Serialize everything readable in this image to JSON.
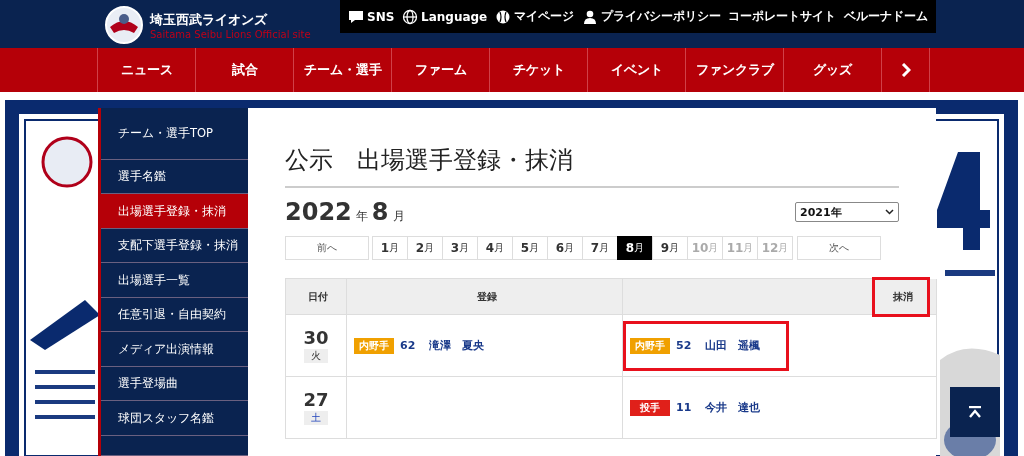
{
  "header": {
    "site_name": "埼玉西武ライオンズ",
    "site_subtitle": "Saitama Seibu Lions Official site"
  },
  "top_links": [
    {
      "label": "SNS"
    },
    {
      "label": "Language"
    },
    {
      "label": "マイページ"
    },
    {
      "label": "プライバシーポリシー"
    },
    {
      "label": "コーポレートサイト"
    },
    {
      "label": "ベルーナドーム"
    }
  ],
  "main_nav": [
    "ニュース",
    "試合",
    "チーム・選手",
    "ファーム",
    "チケット",
    "イベント",
    "ファンクラブ",
    "グッズ"
  ],
  "sidebar": {
    "items": [
      {
        "label": "チーム・選手TOP",
        "selected": false
      },
      {
        "label": "選手名鑑",
        "selected": false
      },
      {
        "label": "出場選手登録・抹消",
        "selected": true
      },
      {
        "label": "支配下選手登録・抹消",
        "selected": false
      },
      {
        "label": "出場選手一覧",
        "selected": false
      },
      {
        "label": "任意引退・自由契約",
        "selected": false
      },
      {
        "label": "メディア出演情報",
        "selected": false
      },
      {
        "label": "選手登場曲",
        "selected": false
      },
      {
        "label": "球団スタッフ名鑑",
        "selected": false
      }
    ]
  },
  "page_title": "公示　出場選手登録・抹消",
  "period": {
    "year": "2022",
    "year_unit": "年",
    "month": "8",
    "month_unit": "月"
  },
  "year_select": {
    "value": "2021年"
  },
  "month_nav": {
    "prev": "前へ",
    "next": "次へ",
    "months": [
      {
        "number": "1",
        "unit": "月",
        "selected": false,
        "disabled": false
      },
      {
        "number": "2",
        "unit": "月",
        "selected": false,
        "disabled": false
      },
      {
        "number": "3",
        "unit": "月",
        "selected": false,
        "disabled": false
      },
      {
        "number": "4",
        "unit": "月",
        "selected": false,
        "disabled": false
      },
      {
        "number": "5",
        "unit": "月",
        "selected": false,
        "disabled": false
      },
      {
        "number": "6",
        "unit": "月",
        "selected": false,
        "disabled": false
      },
      {
        "number": "7",
        "unit": "月",
        "selected": false,
        "disabled": false
      },
      {
        "number": "8",
        "unit": "月",
        "selected": true,
        "disabled": false
      },
      {
        "number": "9",
        "unit": "月",
        "selected": false,
        "disabled": false
      },
      {
        "number": "10",
        "unit": "月",
        "selected": false,
        "disabled": true
      },
      {
        "number": "11",
        "unit": "月",
        "selected": false,
        "disabled": true
      },
      {
        "number": "12",
        "unit": "月",
        "selected": false,
        "disabled": true
      }
    ]
  },
  "table": {
    "columns": [
      {
        "label": "日付",
        "highlighted": false
      },
      {
        "label": "登録",
        "highlighted": false
      },
      {
        "label": "抹消",
        "highlighted": true
      }
    ],
    "rows": [
      {
        "day": "30",
        "weekday": "火",
        "weekend": false,
        "registered": [
          {
            "position": "内野手",
            "color": "#f0a000",
            "number": "62",
            "name": "滝澤　夏央",
            "highlighted": false
          }
        ],
        "removed": [
          {
            "position": "内野手",
            "color": "#f0a000",
            "number": "52",
            "name": "山田　遥楓",
            "highlighted": true
          }
        ]
      },
      {
        "day": "27",
        "weekday": "土",
        "weekend": true,
        "removed": [
          {
            "position": "投手",
            "color": "#e0201a",
            "number": "11",
            "name": "今井　達也",
            "highlighted": false
          }
        ]
      }
    ]
  }
}
